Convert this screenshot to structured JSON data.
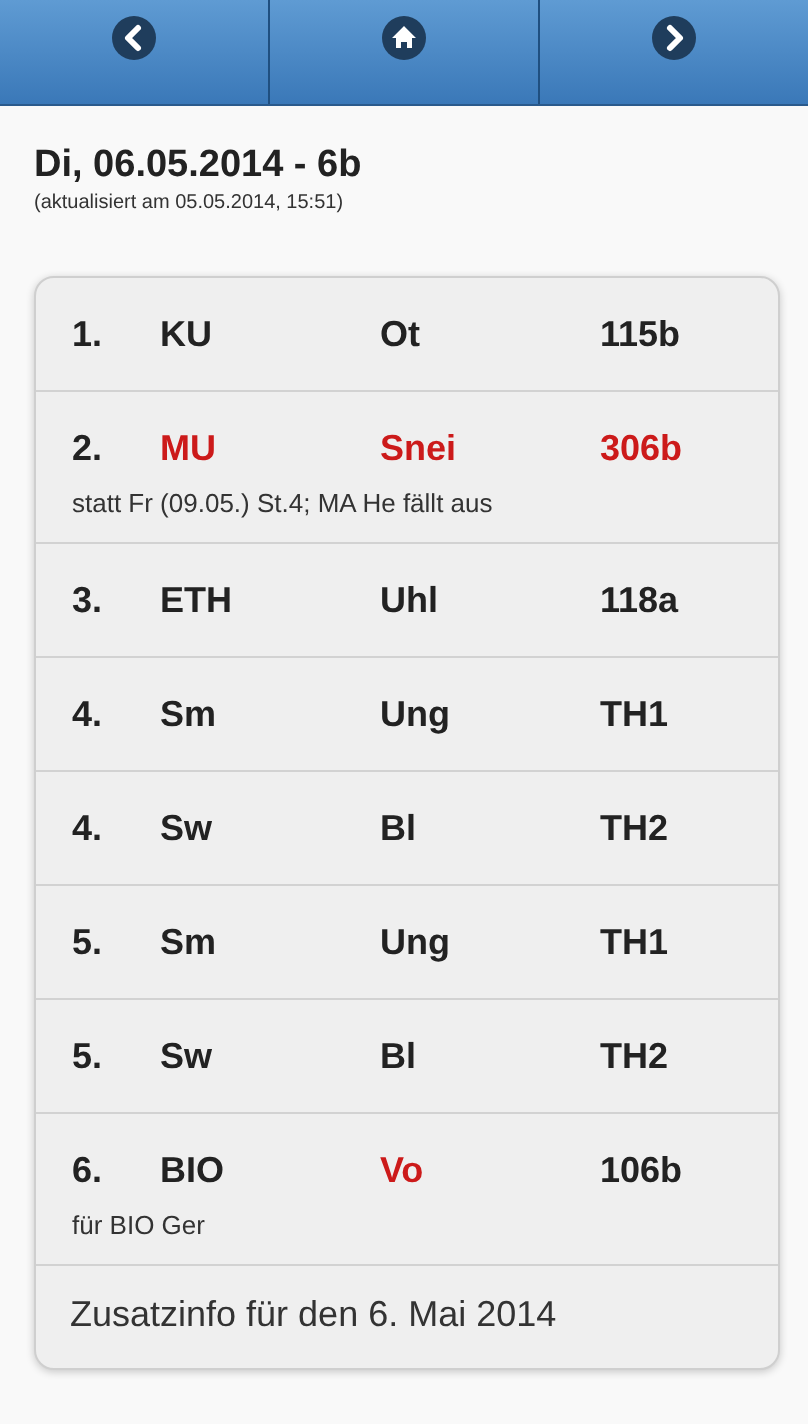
{
  "nav": [
    {
      "kind": "prev"
    },
    {
      "kind": "home"
    },
    {
      "kind": "next"
    }
  ],
  "header": {
    "title": "Di, 06.05.2014 - 6b",
    "updated": "(aktualisiert am 05.05.2014, 15:51)"
  },
  "rows": [
    {
      "period": "1.",
      "subject": {
        "text": "KU",
        "changed": false
      },
      "teacher": {
        "text": "Ot",
        "changed": false
      },
      "room": {
        "text": "115b",
        "changed": false
      }
    },
    {
      "period": "2.",
      "subject": {
        "text": "MU",
        "changed": true
      },
      "teacher": {
        "text": "Snei",
        "changed": true
      },
      "room": {
        "text": "306b",
        "changed": true
      },
      "note": "statt Fr (09.05.) St.4; MA He fällt aus"
    },
    {
      "period": "3.",
      "subject": {
        "text": "ETH",
        "changed": false
      },
      "teacher": {
        "text": "Uhl",
        "changed": false
      },
      "room": {
        "text": "118a",
        "changed": false
      }
    },
    {
      "period": "4.",
      "subject": {
        "text": "Sm",
        "changed": false
      },
      "teacher": {
        "text": "Ung",
        "changed": false
      },
      "room": {
        "text": "TH1",
        "changed": false
      }
    },
    {
      "period": "4.",
      "subject": {
        "text": "Sw",
        "changed": false
      },
      "teacher": {
        "text": "Bl",
        "changed": false
      },
      "room": {
        "text": "TH2",
        "changed": false
      }
    },
    {
      "period": "5.",
      "subject": {
        "text": "Sm",
        "changed": false
      },
      "teacher": {
        "text": "Ung",
        "changed": false
      },
      "room": {
        "text": "TH1",
        "changed": false
      }
    },
    {
      "period": "5.",
      "subject": {
        "text": "Sw",
        "changed": false
      },
      "teacher": {
        "text": "Bl",
        "changed": false
      },
      "room": {
        "text": "TH2",
        "changed": false
      }
    },
    {
      "period": "6.",
      "subject": {
        "text": "BIO",
        "changed": false
      },
      "teacher": {
        "text": "Vo",
        "changed": true
      },
      "room": {
        "text": "106b",
        "changed": false
      },
      "note": "für BIO Ger"
    }
  ],
  "footer": "Zusatzinfo für den 6. Mai 2014"
}
